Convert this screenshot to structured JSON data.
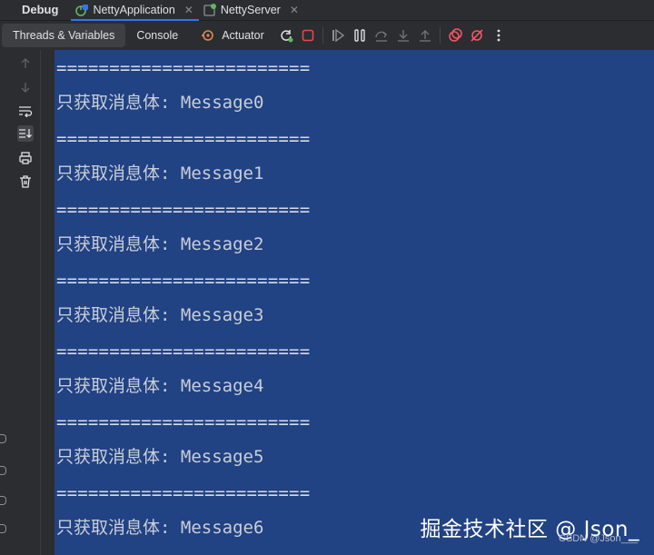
{
  "window": {
    "title": "Debug",
    "tabs": [
      {
        "label": "NettyApplication",
        "icon": "spring-boot-icon",
        "closable": true,
        "active": true
      },
      {
        "label": "NettyServer",
        "icon": "java-class-icon",
        "closable": true,
        "active": false
      }
    ]
  },
  "toolbar": {
    "tabs": [
      {
        "label": "Threads & Variables"
      },
      {
        "label": "Console",
        "selected": true
      },
      {
        "label": "Actuator",
        "icon": "actuator-icon"
      }
    ],
    "actions": [
      "rerun-icon",
      "stop-icon",
      "resume-icon",
      "pause-icon",
      "step-over-icon",
      "step-into-icon",
      "step-out-icon",
      "view-breakpoints-icon",
      "mute-breakpoints-icon",
      "more-icon"
    ]
  },
  "gutter": {
    "icons": [
      "up-arrow-icon",
      "down-arrow-icon",
      "soft-wrap-icon",
      "scroll-to-end-icon",
      "print-icon",
      "trash-icon"
    ]
  },
  "console": {
    "lines": [
      "========================",
      "只获取消息体: Message0",
      "========================",
      "只获取消息体: Message1",
      "========================",
      "只获取消息体: Message2",
      "========================",
      "只获取消息体: Message3",
      "========================",
      "只获取消息体: Message4",
      "========================",
      "只获取消息体: Message5",
      "========================",
      "只获取消息体: Message6"
    ],
    "background": "#214283"
  },
  "watermark": {
    "text": "掘金技术社区 @ Json_",
    "subtext": "CSDN @Json___"
  },
  "colors": {
    "accent": "#3574f0",
    "stop": "#e5484d",
    "breakpoint": "#f75464"
  }
}
